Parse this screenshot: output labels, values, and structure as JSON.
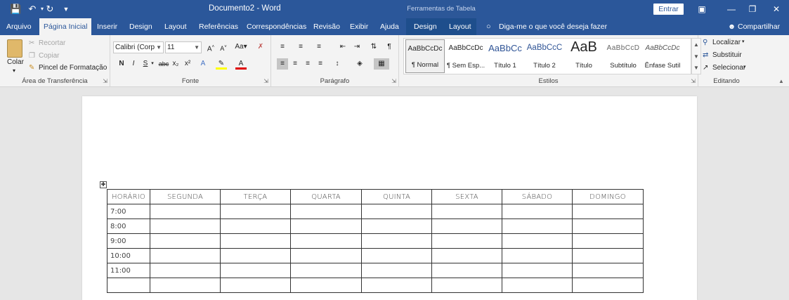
{
  "titlebar": {
    "title": "Documento2 - Word",
    "context_title": "Ferramentas de Tabela",
    "signin": "Entrar"
  },
  "tabs": [
    "Arquivo",
    "Página Inicial",
    "Inserir",
    "Design",
    "Layout",
    "Referências",
    "Correspondências",
    "Revisão",
    "Exibir",
    "Ajuda",
    "Design",
    "Layout"
  ],
  "tell_me": "Diga-me o que você deseja fazer",
  "share": "Compartilhar",
  "clipboard": {
    "paste": "Colar",
    "cut": "Recortar",
    "copy": "Copiar",
    "format_painter": "Pincel de Formatação",
    "label": "Área de Transferência"
  },
  "font": {
    "family": "Calibri (Corp",
    "size": "11",
    "label": "Fonte",
    "bold": "N",
    "italic": "I",
    "underline": "S",
    "strike": "abc",
    "sub": "x₂",
    "sup": "x²",
    "case": "Aa",
    "grow": "A",
    "shrink": "A"
  },
  "paragraph": {
    "label": "Parágrafo"
  },
  "styles": {
    "label": "Estilos",
    "items": [
      {
        "preview": "AaBbCcDc",
        "name": "¶ Normal"
      },
      {
        "preview": "AaBbCcDc",
        "name": "¶ Sem Esp..."
      },
      {
        "preview": "AaBbCc",
        "name": "Título 1"
      },
      {
        "preview": "AaBbCcC",
        "name": "Título 2"
      },
      {
        "preview": "AaB",
        "name": "Título"
      },
      {
        "preview": "AaBbCcD",
        "name": "Subtítulo"
      },
      {
        "preview": "AaBbCcDc",
        "name": "Ênfase Sutil"
      }
    ]
  },
  "editing": {
    "label": "Editando",
    "find": "Localizar",
    "replace": "Substituir",
    "select": "Selecionar"
  },
  "table": {
    "headers": [
      "HORÁRIO",
      "SEGUNDA",
      "TERÇA",
      "QUARTA",
      "QUINTA",
      "SEXTA",
      "SÁBADO",
      "DOMINGO"
    ],
    "times": [
      "7:00",
      "8:00",
      "9:00",
      "10:00",
      "11:00",
      ""
    ]
  },
  "colors": {
    "word_blue": "#2b579a",
    "ribbon": "#f3f3f3",
    "canvas": "#e6e6e6"
  }
}
